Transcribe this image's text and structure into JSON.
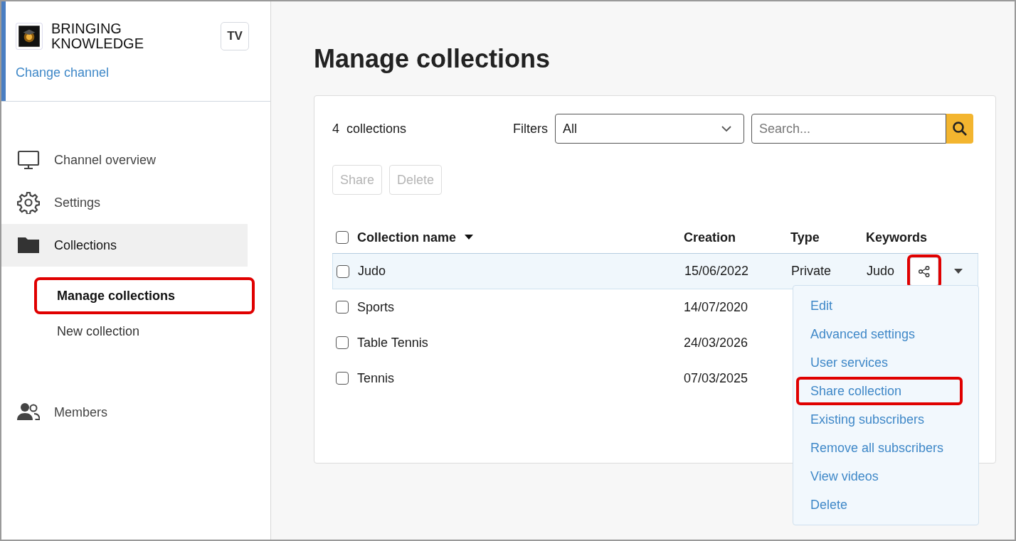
{
  "channel": {
    "name_lines": [
      "BRINGING",
      "KNOWLEDGE"
    ],
    "badge": "TV",
    "change_link": "Change channel"
  },
  "nav": [
    {
      "kind": "monitor",
      "label": "Channel overview",
      "selected": false
    },
    {
      "kind": "gear",
      "label": "Settings",
      "selected": false
    },
    {
      "kind": "folder",
      "label": "Collections",
      "selected": true,
      "children": [
        {
          "label": "Manage collections",
          "selected": true,
          "highlighted": true
        },
        {
          "label": "New collection",
          "selected": false,
          "highlighted": false
        }
      ]
    },
    {
      "kind": "people",
      "label": "Members",
      "selected": false
    }
  ],
  "page_title": "Manage collections",
  "count": {
    "number": "4",
    "label": "collections"
  },
  "filters": {
    "label": "Filters",
    "value": "All"
  },
  "search": {
    "placeholder": "Search..."
  },
  "bulk_buttons": [
    {
      "label": "Share",
      "disabled": true
    },
    {
      "label": "Delete",
      "disabled": true
    }
  ],
  "table": {
    "select_all_checked": false,
    "columns": [
      "Collection name",
      "Creation",
      "Type",
      "Keywords"
    ],
    "rows": [
      {
        "name": "Judo",
        "creation": "15/06/2022",
        "type": "Private",
        "keywords": "Judo",
        "checked": false,
        "selected": true,
        "share_highlighted": true
      },
      {
        "name": "Sports",
        "creation": "14/07/2020",
        "checked": false,
        "selected": false
      },
      {
        "name": "Table Tennis",
        "creation": "24/03/2026",
        "checked": false,
        "selected": false
      },
      {
        "name": "Tennis",
        "creation": "07/03/2025",
        "checked": false,
        "selected": false
      }
    ]
  },
  "row_menu": [
    {
      "label": "Edit",
      "highlighted": false
    },
    {
      "label": "Advanced settings",
      "highlighted": false
    },
    {
      "label": "User services",
      "highlighted": false
    },
    {
      "label": "Share collection",
      "highlighted": true
    },
    {
      "label": "Existing subscribers",
      "highlighted": false
    },
    {
      "label": "Remove all subscribers",
      "highlighted": false
    },
    {
      "label": "View videos",
      "highlighted": false
    },
    {
      "label": "Delete",
      "highlighted": false
    }
  ]
}
